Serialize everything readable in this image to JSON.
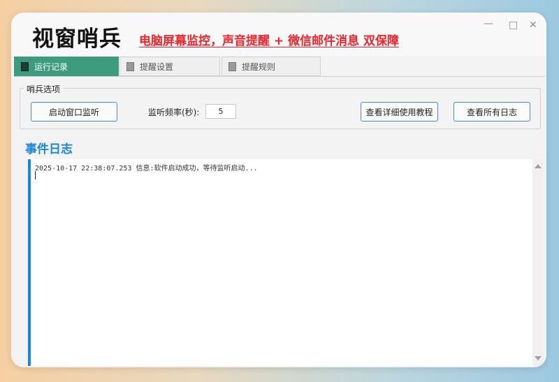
{
  "window": {
    "title": "视窗哨兵",
    "tagline": "电脑屏幕监控，声音提醒 + 微信邮件消息 双保障",
    "controls": {
      "minimize": "—",
      "maximize": "□",
      "close": "✕"
    }
  },
  "tabs": [
    {
      "label": "运行记录",
      "icon": "doc-icon",
      "active": true
    },
    {
      "label": "提醒设置",
      "icon": "doc-icon",
      "active": false
    },
    {
      "label": "提醒规则",
      "icon": "doc-icon",
      "active": false
    }
  ],
  "options": {
    "title": "哨兵选项",
    "start_button": "启动窗口监听",
    "frequency_label": "监听频率(秒):",
    "frequency_value": "5",
    "tutorial_button": "查看详细使用教程",
    "logs_button": "查看所有日志"
  },
  "events": {
    "title": "事件日志",
    "lines": [
      "2025-10-17 22:38:07.253 信息:软件启动成功，等待监听启动..."
    ]
  },
  "colors": {
    "accent": "#3c9c7d",
    "brand_blue": "#1e86d6",
    "tagline_red": "#e8262d"
  }
}
